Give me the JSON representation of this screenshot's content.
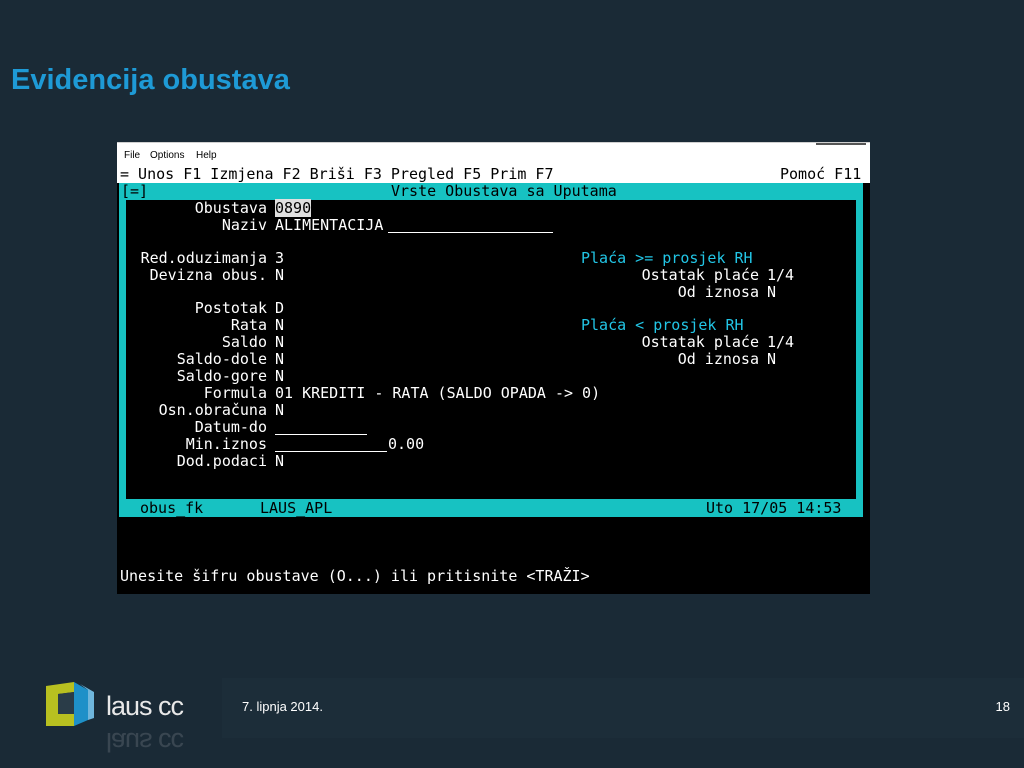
{
  "slide": {
    "title": "Evidencija obustava",
    "date": "7. lipnja 2014.",
    "page_number": "18",
    "logo_text": "laus cc"
  },
  "app": {
    "menu": [
      "File",
      "Options",
      "Help"
    ],
    "fkeys_line": "= Unos F1 Izmjena F2 Briši F3 Pregled F5 Prim F7",
    "help_key": "Pomoć F11",
    "window_control": "[=]",
    "window_title": "Vrste Obustava sa Uputama",
    "fields": {
      "obustava": {
        "label": "Obustava",
        "value": "0890"
      },
      "naziv": {
        "label": "Naziv",
        "value": "ALIMENTACIJA"
      },
      "red_oduzimanja": {
        "label": "Red.oduzimanja",
        "value": "3"
      },
      "devizna_obus": {
        "label": "Devizna obus.",
        "value": "N"
      },
      "postotak": {
        "label": "Postotak",
        "value": "D"
      },
      "rata": {
        "label": "Rata",
        "value": "N"
      },
      "saldo": {
        "label": "Saldo",
        "value": "N"
      },
      "saldo_dole": {
        "label": "Saldo-dole",
        "value": "N"
      },
      "saldo_gore": {
        "label": "Saldo-gore",
        "value": "N"
      },
      "formula": {
        "label": "Formula",
        "value": "01 KREDITI - RATA (SALDO OPADA -> 0)"
      },
      "osn_obracuna": {
        "label": "Osn.obračuna",
        "value": "N"
      },
      "datum_do": {
        "label": "Datum-do",
        "value": ""
      },
      "min_iznos": {
        "label": "Min.iznos",
        "value": "0.00"
      },
      "dod_podaci": {
        "label": "Dod.podaci",
        "value": "N"
      }
    },
    "placa_ge": {
      "heading": "Plaća >= prosjek RH",
      "ostatak_label": "Ostatak plaće",
      "ostatak_value": "1/4",
      "od_iznosa_label": "Od iznosa",
      "od_iznosa_value": "N"
    },
    "placa_lt": {
      "heading": "Plaća < prosjek RH",
      "ostatak_label": "Ostatak plaće",
      "ostatak_value": "1/4",
      "od_iznosa_label": "Od iznosa",
      "od_iznosa_value": "N"
    },
    "status": {
      "table": "obus_fk",
      "app_name": "LAUS_APL",
      "datetime": "Uto 17/05 14:53"
    },
    "prompt": "Unesite šifru obustave (O...) ili pritisnite <TRAŽI>"
  },
  "colors": {
    "title": "#1e9ad6",
    "panel": "#17c2c2",
    "highlight_text": "#22c6e6",
    "background": "#1a2a36"
  }
}
